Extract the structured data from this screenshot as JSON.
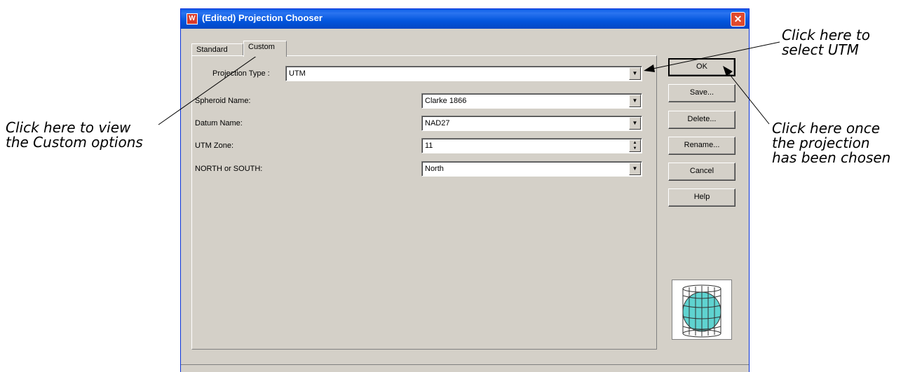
{
  "window": {
    "title": "(Edited) Projection Chooser",
    "app_icon": "W",
    "close_glyph": "✕"
  },
  "tabs": [
    {
      "label": "Standard",
      "active": false
    },
    {
      "label": "Custom",
      "active": true
    }
  ],
  "form": {
    "projection_type": {
      "label": "Projection Type :",
      "value": "UTM"
    },
    "spheroid_name": {
      "label": "Spheroid Name:",
      "value": "Clarke 1866"
    },
    "datum_name": {
      "label": "Datum Name:",
      "value": "NAD27"
    },
    "utm_zone": {
      "label": "UTM Zone:",
      "value": "11"
    },
    "north_south": {
      "label": "NORTH or SOUTH:",
      "value": "North"
    }
  },
  "buttons": {
    "ok": "OK",
    "save": "Save...",
    "delete": "Delete...",
    "rename": "Rename...",
    "cancel": "Cancel",
    "help": "Help"
  },
  "annotations": {
    "select_utm": "Click here to\nselect UTM",
    "custom_options": "Click here to view\nthe Custom options",
    "once_chosen": "Click here once\nthe projection\nhas been chosen"
  },
  "icons": {
    "dropdown": "chevron-down-icon",
    "spinner": "spinner-icon",
    "globe": "globe-projection-icon",
    "close": "close-icon"
  },
  "colors": {
    "titlebar": "#0255dd",
    "dialog_bg": "#d4d0c8",
    "globe_fill": "#5fd3d0"
  }
}
